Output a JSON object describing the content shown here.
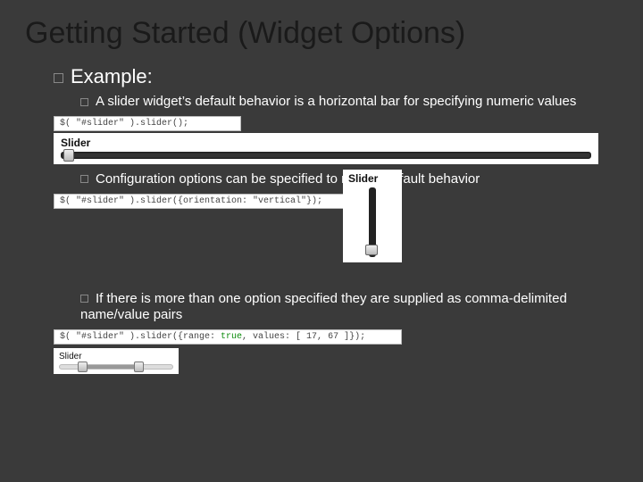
{
  "title": "Getting Started (Widget Options)",
  "example_heading": "Example:",
  "bullets": {
    "b1": "A slider widget’s default behavior is a horizontal bar for specifying numeric values",
    "b2": "Configuration options can be specified to modify default behavior",
    "b3": "If there is more than one option specified they are supplied as comma-delimited name/value pairs"
  },
  "code": {
    "c1": "$( \"#slider\" ).slider();",
    "c2": "$( \"#slider\" ).slider({orientation: \"vertical\"});",
    "c3_pre": "$( \"#slider\" ).slider({range: ",
    "c3_kw": "true",
    "c3_post": ", values: [ 17, 67 ]});"
  },
  "slider_label": "Slider"
}
